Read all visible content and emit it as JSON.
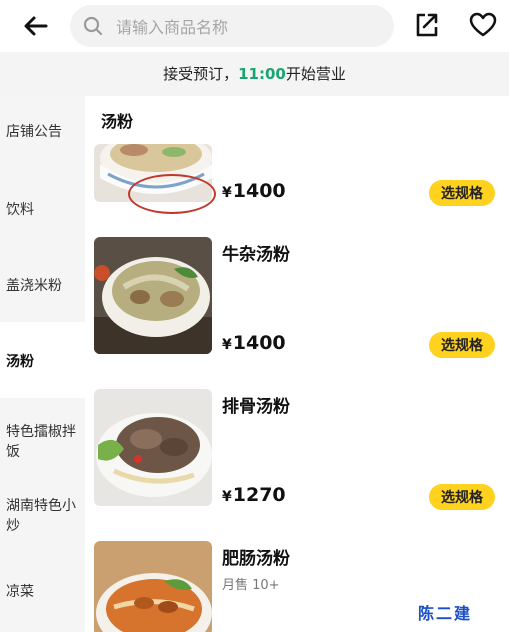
{
  "search": {
    "placeholder": "请输入商品名称"
  },
  "notice": {
    "prefix": "接受预订，",
    "time": "11:00",
    "suffix": "开始营业"
  },
  "sidebar": {
    "items": [
      {
        "label": "店铺公告"
      },
      {
        "label": "饮料"
      },
      {
        "label": "盖浇米粉"
      },
      {
        "label": "汤粉"
      },
      {
        "label": "特色擂椒拌饭"
      },
      {
        "label": "湖南特色小炒"
      },
      {
        "label": "凉菜"
      }
    ],
    "active_index": 3
  },
  "section": {
    "title": "汤粉"
  },
  "dishes": [
    {
      "name": "",
      "price_symbol": "¥",
      "price": "1400",
      "button": "选规格"
    },
    {
      "name": "牛杂汤粉",
      "price_symbol": "¥",
      "price": "1400",
      "button": "选规格"
    },
    {
      "name": "排骨汤粉",
      "price_symbol": "¥",
      "price": "1270",
      "button": "选规格"
    },
    {
      "name": "肥肠汤粉",
      "sales": "月售 10+"
    }
  ],
  "watermark": "陈二建",
  "colors": {
    "accent_yellow": "#ffd21f",
    "notice_time_green": "#19a572",
    "annotation_red": "#c0392b"
  }
}
